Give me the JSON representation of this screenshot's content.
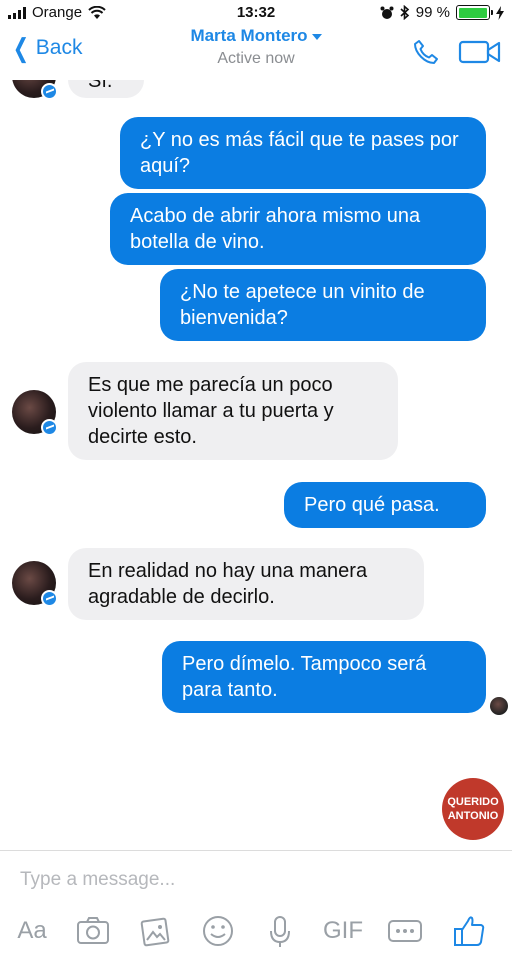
{
  "status_bar": {
    "carrier": "Orange",
    "time": "13:32",
    "battery_percent": "99 %",
    "battery_level": 0.99
  },
  "header": {
    "back_label": "Back",
    "contact_name": "Marta Montero",
    "contact_status": "Active now"
  },
  "messages": [
    {
      "from": "me",
      "text": "¿Y no es más fácil que te pases por aquí?"
    },
    {
      "from": "me",
      "text": "Acabo de abrir ahora mismo una botella de vino."
    },
    {
      "from": "me",
      "text": "¿No te apetece un vinito de bienvenida?"
    },
    {
      "from": "them",
      "text": "Es que me parecía un poco violento llamar a tu puerta y decirte esto."
    },
    {
      "from": "me",
      "text": "Pero qué pasa."
    },
    {
      "from": "them",
      "text": "En realidad no hay una manera agradable de decirlo."
    },
    {
      "from": "me",
      "text": "Pero dímelo. Tampoco será para tanto."
    }
  ],
  "partial_message": {
    "text": "Sí."
  },
  "watermark": {
    "line1": "QUERIDO",
    "line2": "ANTONIO"
  },
  "composer": {
    "placeholder": "Type a message...",
    "aa_label": "Aa",
    "gif_label": "GIF"
  },
  "colors": {
    "accent": "#1e88e5",
    "outgoing_bubble": "#0b7de2",
    "incoming_bubble": "#efeff1",
    "watermark": "#c0392b"
  }
}
